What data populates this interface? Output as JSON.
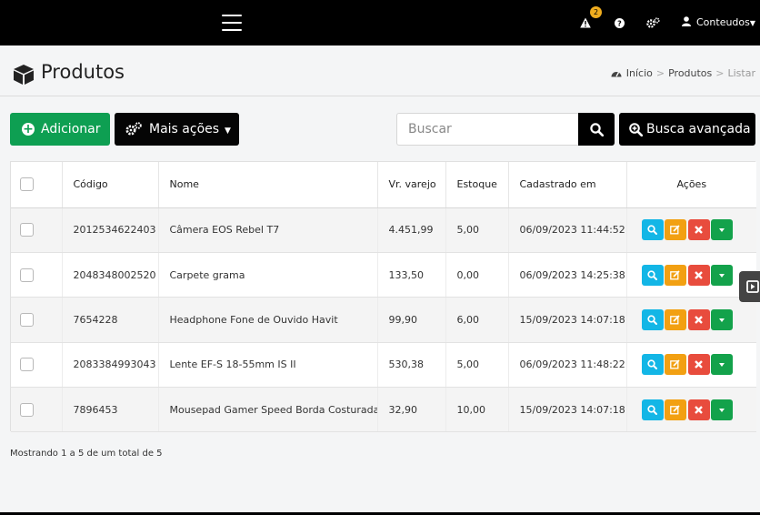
{
  "topbar": {
    "notification_count": "2",
    "user_label": "Conteudos"
  },
  "header": {
    "title": "Produtos",
    "breadcrumb": [
      "Início",
      "Produtos",
      "Listar"
    ]
  },
  "toolbar": {
    "add_label": "Adicionar",
    "more_label": "Mais ações",
    "search_placeholder": "Buscar",
    "advanced_search_label": "Busca avançada"
  },
  "table": {
    "columns": [
      "Código",
      "Nome",
      "Vr. varejo",
      "Estoque",
      "Cadastrado em",
      "Ações"
    ],
    "rows": [
      {
        "code": "2012534622403",
        "name": "Câmera EOS Rebel T7",
        "price": "4.451,99",
        "stock": "5,00",
        "created": "06/09/2023 11:44:52"
      },
      {
        "code": "2048348002520",
        "name": "Carpete grama",
        "price": "133,50",
        "stock": "0,00",
        "created": "06/09/2023 14:25:38"
      },
      {
        "code": "7654228",
        "name": "Headphone Fone de Ouvido Havit",
        "price": "99,90",
        "stock": "6,00",
        "created": "15/09/2023 14:07:18"
      },
      {
        "code": "2083384993043",
        "name": "Lente EF-S 18-55mm IS II",
        "price": "530,38",
        "stock": "5,00",
        "created": "06/09/2023 11:48:22"
      },
      {
        "code": "7896453",
        "name": "Mousepad Gamer Speed Borda Costurada",
        "price": "32,90",
        "stock": "10,00",
        "created": "15/09/2023 14:07:18"
      }
    ]
  },
  "footer": {
    "summary": "Mostrando 1 a 5 de um total de 5"
  },
  "colors": {
    "add_button": "#0e9f52",
    "view_action": "#13b6e6",
    "edit_action": "#f2a012",
    "delete_action": "#e84c3d",
    "more_action": "#13a24b",
    "badge": "#f0ad1e"
  },
  "icons": [
    "menu-icon",
    "warning-icon",
    "help-icon",
    "settings-icon",
    "user-icon",
    "cube-icon",
    "dashboard-icon",
    "plus-circle-icon",
    "gears-icon",
    "search-icon",
    "search-plus-icon",
    "view-icon",
    "edit-icon",
    "delete-icon",
    "caret-down-icon",
    "panel-toggle-icon"
  ]
}
